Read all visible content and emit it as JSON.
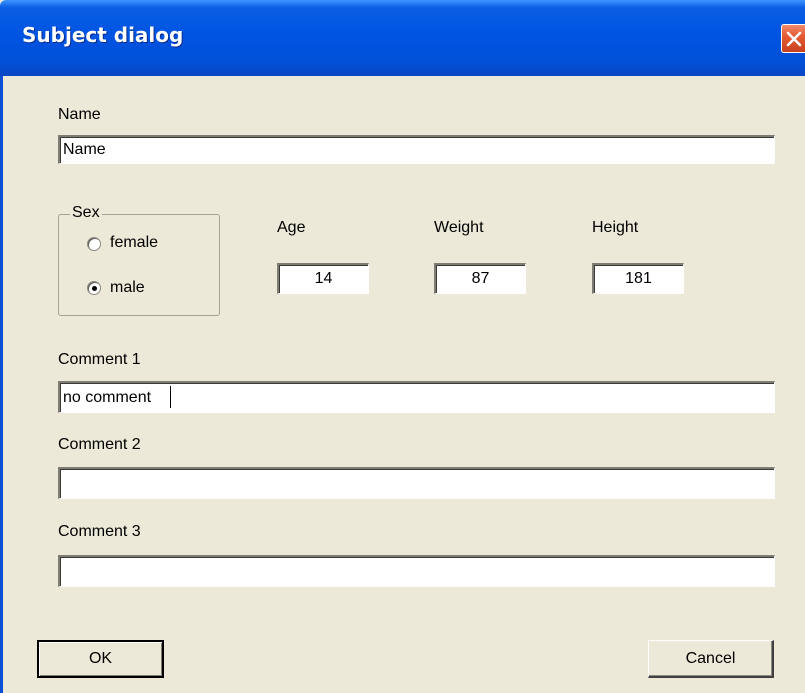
{
  "window": {
    "title": "Subject dialog",
    "close_icon": "close-icon"
  },
  "form": {
    "name": {
      "label": "Name",
      "value": "Name"
    },
    "sex": {
      "label": "Sex",
      "options": [
        {
          "label": "female",
          "selected": false
        },
        {
          "label": "male",
          "selected": true
        }
      ]
    },
    "age": {
      "label": "Age",
      "value": "14"
    },
    "weight": {
      "label": "Weight",
      "value": "87"
    },
    "height": {
      "label": "Height",
      "value": "181"
    },
    "comment1": {
      "label": "Comment 1",
      "value": "no comment"
    },
    "comment2": {
      "label": "Comment 2",
      "value": ""
    },
    "comment3": {
      "label": "Comment 3",
      "value": ""
    }
  },
  "buttons": {
    "ok": "OK",
    "cancel": "Cancel"
  },
  "colors": {
    "titlebar": "#0054e3",
    "close_button": "#e45b34",
    "dialog_background": "#ece9d8"
  }
}
